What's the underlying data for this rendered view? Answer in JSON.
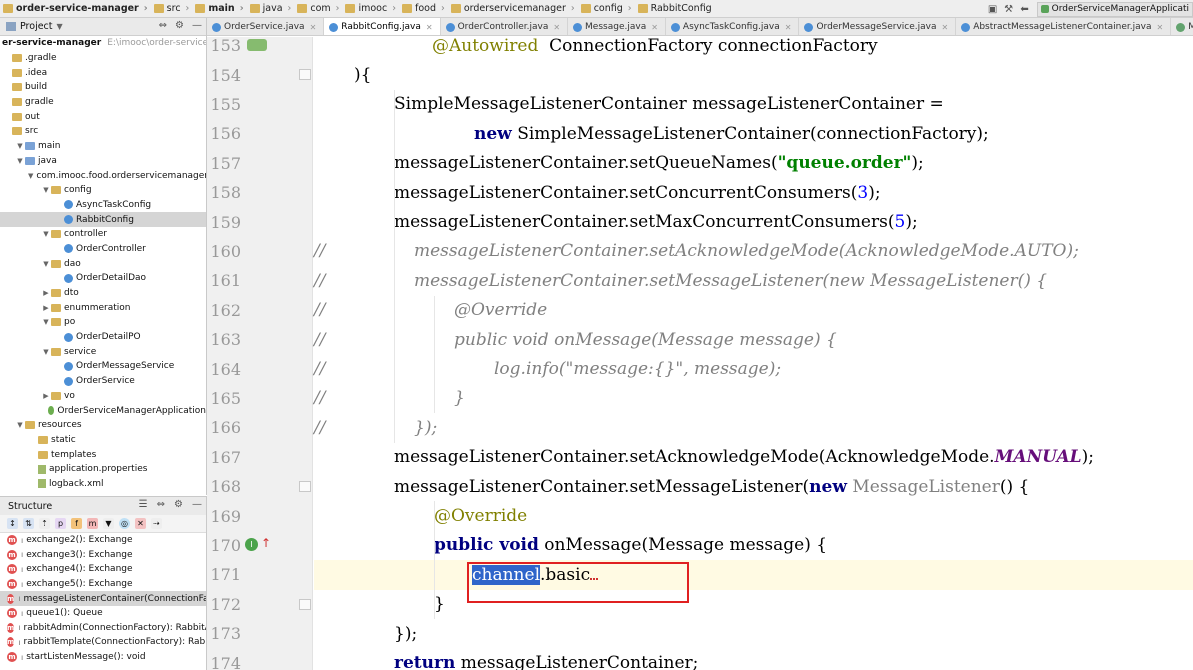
{
  "navbar": {
    "crumbs": [
      {
        "label": "order-service-manager",
        "bold": true
      },
      {
        "label": "src"
      },
      {
        "label": "main",
        "bold": true
      },
      {
        "label": "java"
      },
      {
        "label": "com"
      },
      {
        "label": "imooc"
      },
      {
        "label": "food"
      },
      {
        "label": "orderservicemanager"
      },
      {
        "label": "config"
      },
      {
        "label": "RabbitConfig"
      }
    ],
    "run_config": "OrderServiceManagerApplicati"
  },
  "project": {
    "title": "Project",
    "root_label": "er-service-manager",
    "root_path": "E:\\imooc\\order-service-man",
    "tree": [
      {
        "label": ".gradle",
        "depth": 0
      },
      {
        "label": ".idea",
        "depth": 0
      },
      {
        "label": "build",
        "depth": 0
      },
      {
        "label": "gradle",
        "depth": 0
      },
      {
        "label": "out",
        "depth": 0
      },
      {
        "label": "src",
        "depth": 0
      },
      {
        "label": "main",
        "depth": 1
      },
      {
        "label": "java",
        "depth": 1
      },
      {
        "label": "com.imooc.food.orderservicemanager",
        "depth": 2
      },
      {
        "label": "config",
        "depth": 3
      },
      {
        "label": "AsyncTaskConfig",
        "depth": 4
      },
      {
        "label": "RabbitConfig",
        "depth": 4
      },
      {
        "label": "controller",
        "depth": 3
      },
      {
        "label": "OrderController",
        "depth": 4
      },
      {
        "label": "dao",
        "depth": 3
      },
      {
        "label": "OrderDetailDao",
        "depth": 4
      },
      {
        "label": "dto",
        "depth": 3
      },
      {
        "label": "enummeration",
        "depth": 3
      },
      {
        "label": "po",
        "depth": 3
      },
      {
        "label": "OrderDetailPO",
        "depth": 4
      },
      {
        "label": "service",
        "depth": 3
      },
      {
        "label": "OrderMessageService",
        "depth": 4
      },
      {
        "label": "OrderService",
        "depth": 4
      },
      {
        "label": "vo",
        "depth": 3
      },
      {
        "label": "OrderServiceManagerApplication",
        "depth": 3
      },
      {
        "label": "resources",
        "depth": 1
      },
      {
        "label": "static",
        "depth": 2
      },
      {
        "label": "templates",
        "depth": 2
      },
      {
        "label": "application.properties",
        "depth": 2
      },
      {
        "label": "logback.xml",
        "depth": 2
      }
    ]
  },
  "structure": {
    "title": "Structure",
    "items": [
      "exchange2(): Exchange",
      "exchange3(): Exchange",
      "exchange4(): Exchange",
      "exchange5(): Exchange",
      "messageListenerContainer(ConnectionFacto",
      "queue1(): Queue",
      "rabbitAdmin(ConnectionFactory): RabbitAdr",
      "rabbitTemplate(ConnectionFactory): Rabbit",
      "startListenMessage(): void"
    ]
  },
  "tabs": [
    {
      "label": "OrderService.java"
    },
    {
      "label": "RabbitConfig.java"
    },
    {
      "label": "OrderController.java"
    },
    {
      "label": "Message.java"
    },
    {
      "label": "AsyncTaskConfig.java"
    },
    {
      "label": "OrderMessageService.java"
    },
    {
      "label": "AbstractMessageListenerContainer.java"
    },
    {
      "label": "MessageListener.java"
    }
  ],
  "editor": {
    "line_numbers": [
      "153",
      "154",
      "155",
      "156",
      "157",
      "158",
      "159",
      "160",
      "161",
      "162",
      "163",
      "164",
      "165",
      "166",
      "167",
      "168",
      "169",
      "170",
      "171",
      "172",
      "173",
      "174"
    ],
    "lines": [
      "@Autowired  ConnectionFactory connectionFactory",
      "){",
      "SimpleMessageListenerContainer messageListenerContainer =",
      "new SimpleMessageListenerContainer(connectionFactory);",
      "messageListenerContainer.setQueueNames(\"queue.order\");",
      "messageListenerContainer.setConcurrentConsumers(3);",
      "messageListenerContainer.setMaxConcurrentConsumers(5);",
      "messageListenerContainer.setAcknowledgeMode(AcknowledgeMode.AUTO);",
      "messageListenerContainer.setMessageListener(new MessageListener() {",
      "@Override",
      "public void onMessage(Message message) {",
      "log.info(\"message:{}\", message);",
      "}",
      "});",
      "messageListenerContainer.setAcknowledgeMode(AcknowledgeMode.MANUAL);",
      "messageListenerContainer.setMessageListener(new MessageListener() {",
      "@Override",
      "public void onMessage(Message message) {",
      "channel.basic",
      "}",
      "});",
      "return messageListenerContainer;"
    ],
    "comment_prefix": "//"
  }
}
